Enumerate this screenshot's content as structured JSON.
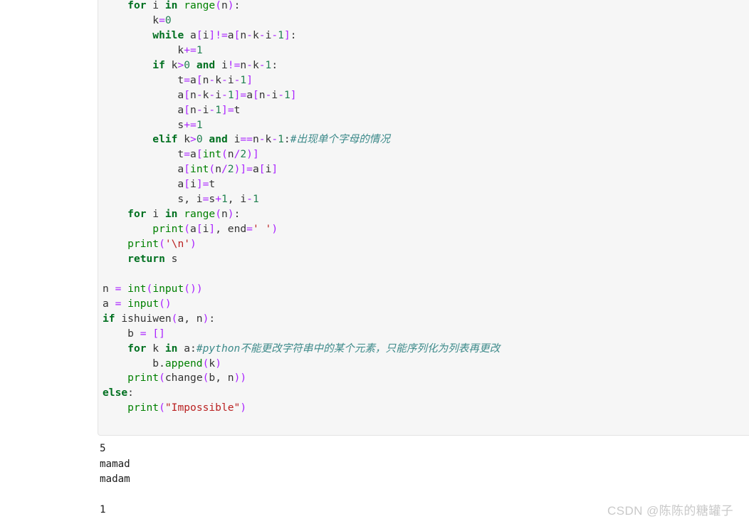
{
  "page": {
    "background": "#ffffff"
  },
  "code_block": {
    "background": "#f6f6f6",
    "border_color": "#e4e4e4",
    "language": "python",
    "lines": [
      [
        {
          "t": "    ",
          "c": "n"
        },
        {
          "t": "for",
          "c": "k"
        },
        {
          "t": " i ",
          "c": "n"
        },
        {
          "t": "in",
          "c": "k"
        },
        {
          "t": " ",
          "c": "n"
        },
        {
          "t": "range",
          "c": "nb"
        },
        {
          "t": "(",
          "c": "p"
        },
        {
          "t": "n",
          "c": "n"
        },
        {
          "t": ")",
          "c": "p"
        },
        {
          "t": ":",
          "c": "n"
        }
      ],
      [
        {
          "t": "        k",
          "c": "n"
        },
        {
          "t": "=",
          "c": "o"
        },
        {
          "t": "0",
          "c": "mi"
        }
      ],
      [
        {
          "t": "        ",
          "c": "n"
        },
        {
          "t": "while",
          "c": "k"
        },
        {
          "t": " a",
          "c": "n"
        },
        {
          "t": "[",
          "c": "p"
        },
        {
          "t": "i",
          "c": "n"
        },
        {
          "t": "]",
          "c": "p"
        },
        {
          "t": "!=",
          "c": "o"
        },
        {
          "t": "a",
          "c": "n"
        },
        {
          "t": "[",
          "c": "p"
        },
        {
          "t": "n",
          "c": "n"
        },
        {
          "t": "-",
          "c": "o"
        },
        {
          "t": "k",
          "c": "n"
        },
        {
          "t": "-",
          "c": "o"
        },
        {
          "t": "i",
          "c": "n"
        },
        {
          "t": "-",
          "c": "o"
        },
        {
          "t": "1",
          "c": "mi"
        },
        {
          "t": "]",
          "c": "p"
        },
        {
          "t": ":",
          "c": "n"
        }
      ],
      [
        {
          "t": "            k",
          "c": "n"
        },
        {
          "t": "+=",
          "c": "o"
        },
        {
          "t": "1",
          "c": "mi"
        }
      ],
      [
        {
          "t": "        ",
          "c": "n"
        },
        {
          "t": "if",
          "c": "k"
        },
        {
          "t": " k",
          "c": "n"
        },
        {
          "t": ">",
          "c": "o"
        },
        {
          "t": "0",
          "c": "mi"
        },
        {
          "t": " ",
          "c": "n"
        },
        {
          "t": "and",
          "c": "k"
        },
        {
          "t": " i",
          "c": "n"
        },
        {
          "t": "!=",
          "c": "o"
        },
        {
          "t": "n",
          "c": "n"
        },
        {
          "t": "-",
          "c": "o"
        },
        {
          "t": "k",
          "c": "n"
        },
        {
          "t": "-",
          "c": "o"
        },
        {
          "t": "1",
          "c": "mi"
        },
        {
          "t": ":",
          "c": "n"
        }
      ],
      [
        {
          "t": "            t",
          "c": "n"
        },
        {
          "t": "=",
          "c": "o"
        },
        {
          "t": "a",
          "c": "n"
        },
        {
          "t": "[",
          "c": "p"
        },
        {
          "t": "n",
          "c": "n"
        },
        {
          "t": "-",
          "c": "o"
        },
        {
          "t": "k",
          "c": "n"
        },
        {
          "t": "-",
          "c": "o"
        },
        {
          "t": "i",
          "c": "n"
        },
        {
          "t": "-",
          "c": "o"
        },
        {
          "t": "1",
          "c": "mi"
        },
        {
          "t": "]",
          "c": "p"
        }
      ],
      [
        {
          "t": "            a",
          "c": "n"
        },
        {
          "t": "[",
          "c": "p"
        },
        {
          "t": "n",
          "c": "n"
        },
        {
          "t": "-",
          "c": "o"
        },
        {
          "t": "k",
          "c": "n"
        },
        {
          "t": "-",
          "c": "o"
        },
        {
          "t": "i",
          "c": "n"
        },
        {
          "t": "-",
          "c": "o"
        },
        {
          "t": "1",
          "c": "mi"
        },
        {
          "t": "]",
          "c": "p"
        },
        {
          "t": "=",
          "c": "o"
        },
        {
          "t": "a",
          "c": "n"
        },
        {
          "t": "[",
          "c": "p"
        },
        {
          "t": "n",
          "c": "n"
        },
        {
          "t": "-",
          "c": "o"
        },
        {
          "t": "i",
          "c": "n"
        },
        {
          "t": "-",
          "c": "o"
        },
        {
          "t": "1",
          "c": "mi"
        },
        {
          "t": "]",
          "c": "p"
        }
      ],
      [
        {
          "t": "            a",
          "c": "n"
        },
        {
          "t": "[",
          "c": "p"
        },
        {
          "t": "n",
          "c": "n"
        },
        {
          "t": "-",
          "c": "o"
        },
        {
          "t": "i",
          "c": "n"
        },
        {
          "t": "-",
          "c": "o"
        },
        {
          "t": "1",
          "c": "mi"
        },
        {
          "t": "]",
          "c": "p"
        },
        {
          "t": "=",
          "c": "o"
        },
        {
          "t": "t",
          "c": "n"
        }
      ],
      [
        {
          "t": "            s",
          "c": "n"
        },
        {
          "t": "+=",
          "c": "o"
        },
        {
          "t": "1",
          "c": "mi"
        }
      ],
      [
        {
          "t": "        ",
          "c": "n"
        },
        {
          "t": "elif",
          "c": "k"
        },
        {
          "t": " k",
          "c": "n"
        },
        {
          "t": ">",
          "c": "o"
        },
        {
          "t": "0",
          "c": "mi"
        },
        {
          "t": " ",
          "c": "n"
        },
        {
          "t": "and",
          "c": "k"
        },
        {
          "t": " i",
          "c": "n"
        },
        {
          "t": "==",
          "c": "o"
        },
        {
          "t": "n",
          "c": "n"
        },
        {
          "t": "-",
          "c": "o"
        },
        {
          "t": "k",
          "c": "n"
        },
        {
          "t": "-",
          "c": "o"
        },
        {
          "t": "1",
          "c": "mi"
        },
        {
          "t": ":",
          "c": "n"
        },
        {
          "t": "#出现单个字母的情况",
          "c": "c"
        }
      ],
      [
        {
          "t": "            t",
          "c": "n"
        },
        {
          "t": "=",
          "c": "o"
        },
        {
          "t": "a",
          "c": "n"
        },
        {
          "t": "[",
          "c": "p"
        },
        {
          "t": "int",
          "c": "nb"
        },
        {
          "t": "(",
          "c": "p"
        },
        {
          "t": "n",
          "c": "n"
        },
        {
          "t": "/",
          "c": "o"
        },
        {
          "t": "2",
          "c": "mi"
        },
        {
          "t": ")",
          "c": "p"
        },
        {
          "t": "]",
          "c": "p"
        }
      ],
      [
        {
          "t": "            a",
          "c": "n"
        },
        {
          "t": "[",
          "c": "p"
        },
        {
          "t": "int",
          "c": "nb"
        },
        {
          "t": "(",
          "c": "p"
        },
        {
          "t": "n",
          "c": "n"
        },
        {
          "t": "/",
          "c": "o"
        },
        {
          "t": "2",
          "c": "mi"
        },
        {
          "t": ")",
          "c": "p"
        },
        {
          "t": "]",
          "c": "p"
        },
        {
          "t": "=",
          "c": "o"
        },
        {
          "t": "a",
          "c": "n"
        },
        {
          "t": "[",
          "c": "p"
        },
        {
          "t": "i",
          "c": "n"
        },
        {
          "t": "]",
          "c": "p"
        }
      ],
      [
        {
          "t": "            a",
          "c": "n"
        },
        {
          "t": "[",
          "c": "p"
        },
        {
          "t": "i",
          "c": "n"
        },
        {
          "t": "]",
          "c": "p"
        },
        {
          "t": "=",
          "c": "o"
        },
        {
          "t": "t",
          "c": "n"
        }
      ],
      [
        {
          "t": "            s, i",
          "c": "n"
        },
        {
          "t": "=",
          "c": "o"
        },
        {
          "t": "s",
          "c": "n"
        },
        {
          "t": "+",
          "c": "o"
        },
        {
          "t": "1",
          "c": "mi"
        },
        {
          "t": ", i",
          "c": "n"
        },
        {
          "t": "-",
          "c": "o"
        },
        {
          "t": "1",
          "c": "mi"
        }
      ],
      [
        {
          "t": "    ",
          "c": "n"
        },
        {
          "t": "for",
          "c": "k"
        },
        {
          "t": " i ",
          "c": "n"
        },
        {
          "t": "in",
          "c": "k"
        },
        {
          "t": " ",
          "c": "n"
        },
        {
          "t": "range",
          "c": "nb"
        },
        {
          "t": "(",
          "c": "p"
        },
        {
          "t": "n",
          "c": "n"
        },
        {
          "t": ")",
          "c": "p"
        },
        {
          "t": ":",
          "c": "n"
        }
      ],
      [
        {
          "t": "        ",
          "c": "n"
        },
        {
          "t": "print",
          "c": "nb"
        },
        {
          "t": "(",
          "c": "p"
        },
        {
          "t": "a",
          "c": "n"
        },
        {
          "t": "[",
          "c": "p"
        },
        {
          "t": "i",
          "c": "n"
        },
        {
          "t": "]",
          "c": "p"
        },
        {
          "t": ", end",
          "c": "n"
        },
        {
          "t": "=",
          "c": "o"
        },
        {
          "t": "' '",
          "c": "s"
        },
        {
          "t": ")",
          "c": "p"
        }
      ],
      [
        {
          "t": "    ",
          "c": "n"
        },
        {
          "t": "print",
          "c": "nb"
        },
        {
          "t": "(",
          "c": "p"
        },
        {
          "t": "'\\n'",
          "c": "s"
        },
        {
          "t": ")",
          "c": "p"
        }
      ],
      [
        {
          "t": "    ",
          "c": "n"
        },
        {
          "t": "return",
          "c": "k"
        },
        {
          "t": " s",
          "c": "n"
        }
      ],
      [],
      [
        {
          "t": "n ",
          "c": "n"
        },
        {
          "t": "=",
          "c": "o"
        },
        {
          "t": " ",
          "c": "n"
        },
        {
          "t": "int",
          "c": "nb"
        },
        {
          "t": "(",
          "c": "p"
        },
        {
          "t": "input",
          "c": "nb"
        },
        {
          "t": "(",
          "c": "p"
        },
        {
          "t": ")",
          "c": "p"
        },
        {
          "t": ")",
          "c": "p"
        }
      ],
      [
        {
          "t": "a ",
          "c": "n"
        },
        {
          "t": "=",
          "c": "o"
        },
        {
          "t": " ",
          "c": "n"
        },
        {
          "t": "input",
          "c": "nb"
        },
        {
          "t": "(",
          "c": "p"
        },
        {
          "t": ")",
          "c": "p"
        }
      ],
      [
        {
          "t": "if",
          "c": "k"
        },
        {
          "t": " ishuiwen",
          "c": "n"
        },
        {
          "t": "(",
          "c": "p"
        },
        {
          "t": "a, n",
          "c": "n"
        },
        {
          "t": ")",
          "c": "p"
        },
        {
          "t": ":",
          "c": "n"
        }
      ],
      [
        {
          "t": "    b ",
          "c": "n"
        },
        {
          "t": "=",
          "c": "o"
        },
        {
          "t": " ",
          "c": "n"
        },
        {
          "t": "[",
          "c": "p"
        },
        {
          "t": "]",
          "c": "p"
        }
      ],
      [
        {
          "t": "    ",
          "c": "n"
        },
        {
          "t": "for",
          "c": "k"
        },
        {
          "t": " k ",
          "c": "n"
        },
        {
          "t": "in",
          "c": "k"
        },
        {
          "t": " a",
          "c": "n"
        },
        {
          "t": ":",
          "c": "n"
        },
        {
          "t": "#python不能更改字符串中的某个元素，只能序列化为列表再更改",
          "c": "c"
        }
      ],
      [
        {
          "t": "        b.",
          "c": "n"
        },
        {
          "t": "append",
          "c": "nb"
        },
        {
          "t": "(",
          "c": "p"
        },
        {
          "t": "k",
          "c": "n"
        },
        {
          "t": ")",
          "c": "p"
        }
      ],
      [
        {
          "t": "    ",
          "c": "n"
        },
        {
          "t": "print",
          "c": "nb"
        },
        {
          "t": "(",
          "c": "p"
        },
        {
          "t": "change",
          "c": "n"
        },
        {
          "t": "(",
          "c": "p"
        },
        {
          "t": "b, n",
          "c": "n"
        },
        {
          "t": ")",
          "c": "p"
        },
        {
          "t": ")",
          "c": "p"
        }
      ],
      [
        {
          "t": "else",
          "c": "k"
        },
        {
          "t": ":",
          "c": "n"
        }
      ],
      [
        {
          "t": "    ",
          "c": "n"
        },
        {
          "t": "print",
          "c": "nb"
        },
        {
          "t": "(",
          "c": "p"
        },
        {
          "t": "\"Impossible\"",
          "c": "s"
        },
        {
          "t": ")",
          "c": "p"
        }
      ]
    ]
  },
  "output": {
    "lines": [
      "5",
      "mamad",
      "madam",
      "",
      "1"
    ]
  },
  "watermark": {
    "text": "CSDN @陈陈的糖罐子",
    "color": "#c9c9c9"
  }
}
